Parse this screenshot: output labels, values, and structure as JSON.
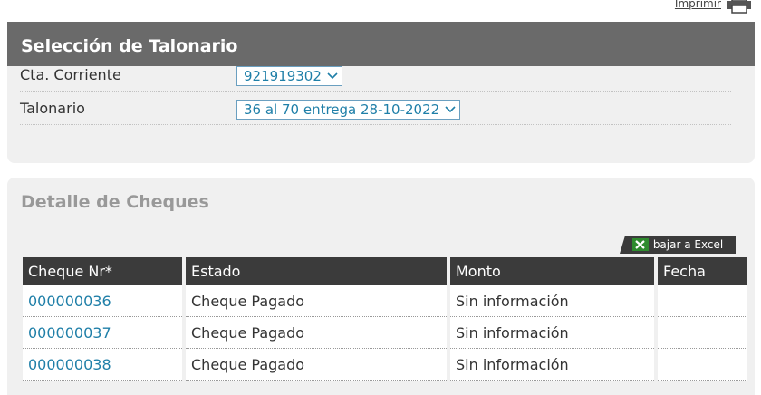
{
  "header": {
    "print_label": "Imprimir"
  },
  "talonario_section": {
    "title": "Selección de Talonario",
    "cuenta": {
      "label": "Cta. Corriente",
      "value": "921919302"
    },
    "talonario": {
      "label": "Talonario",
      "value": "36 al 70 entrega 28-10-2022"
    }
  },
  "detalle_section": {
    "title": "Detalle de Cheques",
    "excel_label": "bajar a Excel",
    "columns": [
      "Cheque Nr*",
      "Estado",
      "Monto",
      "Fecha"
    ],
    "rows": [
      {
        "cheque": "000000036",
        "estado": "Cheque Pagado",
        "monto": "Sin información",
        "fecha": ""
      },
      {
        "cheque": "000000037",
        "estado": "Cheque Pagado",
        "monto": "Sin información",
        "fecha": ""
      },
      {
        "cheque": "000000038",
        "estado": "Cheque Pagado",
        "monto": "Sin información",
        "fecha": ""
      }
    ]
  },
  "icons": {
    "print": "printer-icon",
    "excel": "excel-icon",
    "dropdown": "chevron-down-icon"
  },
  "colors": {
    "header_bg": "#6a6a6a",
    "table_header_bg": "#3b3b3b",
    "link": "#1f7fa8",
    "panel_bg": "#f0f0f0"
  }
}
